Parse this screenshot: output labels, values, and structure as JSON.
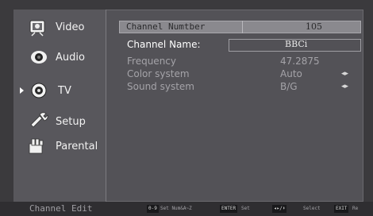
{
  "sidebar": {
    "items": [
      {
        "label": "Video",
        "icon": "video-icon"
      },
      {
        "label": "Audio",
        "icon": "audio-icon"
      },
      {
        "label": "TV",
        "icon": "tv-icon",
        "selected": true
      },
      {
        "label": "Setup",
        "icon": "setup-icon"
      },
      {
        "label": "Parental",
        "icon": "parental-icon"
      }
    ]
  },
  "panel": {
    "channel_number": {
      "label": "Channel Numtber",
      "value": "105"
    },
    "channel_name": {
      "label": "Channel Name:",
      "value": "BBCi"
    },
    "frequency": {
      "label": "Frequency",
      "value": "47.2875"
    },
    "color_system": {
      "label": "Color system",
      "value": "Auto",
      "arrows": "◂▸"
    },
    "sound_system": {
      "label": "Sound system",
      "value": "B/G",
      "arrows": "◂▸"
    }
  },
  "footer": {
    "title": "Channel Edit",
    "hints": [
      {
        "key": "0-9",
        "text": "Set Num&A~Z"
      },
      {
        "key": "ENTER",
        "text": "Set"
      },
      {
        "key": "◂▸/⬍",
        "text": "Select"
      },
      {
        "key": "EXIT",
        "text": "Re"
      }
    ]
  },
  "colors": {
    "background": "#3b3a3d",
    "panel": "#535257",
    "highlight_bar": "#8a898e",
    "footer": "#2f2e31"
  }
}
